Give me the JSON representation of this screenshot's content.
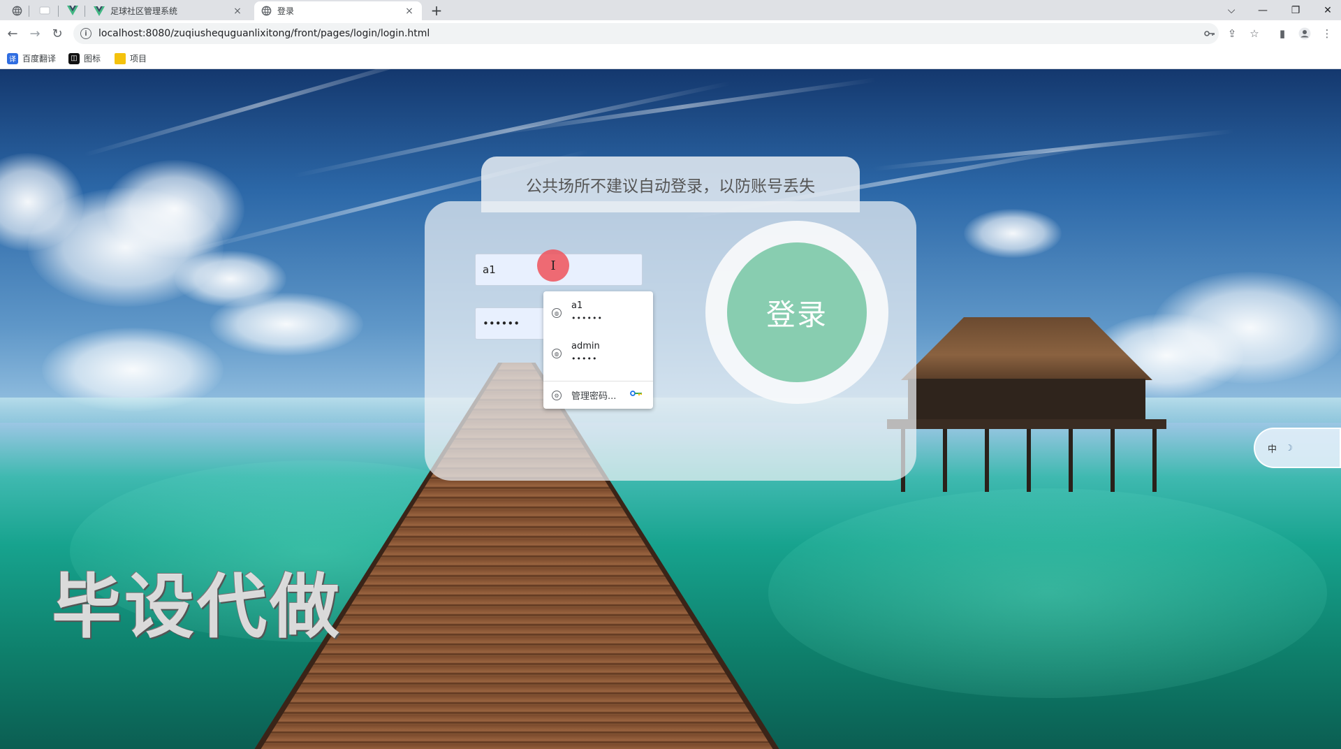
{
  "browser": {
    "tabs": [
      {
        "title": "足球社区管理系统",
        "close": "×"
      },
      {
        "title": "登录",
        "close": "×"
      }
    ],
    "new_tab": "+",
    "window_controls": {
      "collapse": "⌵",
      "minimize": "—",
      "restore": "❐",
      "close": "✕"
    },
    "url": "localhost:8080/zuqiushequguanlixitong/front/pages/login/login.html",
    "bookmarks": [
      {
        "label": "百度翻译",
        "icon": "baidu-translate-icon",
        "color": "#2f6de1"
      },
      {
        "label": "图标",
        "icon": "iconfont-icon",
        "color": "#111111"
      },
      {
        "label": "项目",
        "icon": "folder-icon",
        "color": "#f4c20d"
      }
    ]
  },
  "page": {
    "notice": "公共场所不建议自动登录，以防账号丢失",
    "username_value": "a1",
    "password_value": "••••••",
    "login_label": "登录",
    "watermark": "毕设代做"
  },
  "autofill": {
    "items": [
      {
        "user": "a1",
        "pass": "••••••"
      },
      {
        "user": "admin",
        "pass": "•••••"
      }
    ],
    "manage_label": "管理密码..."
  },
  "ime": {
    "label": "中"
  },
  "colors": {
    "login_button": "#88cdb0",
    "cursor_highlight": "#ee5660",
    "autofill_field": "#e8f0fe"
  }
}
